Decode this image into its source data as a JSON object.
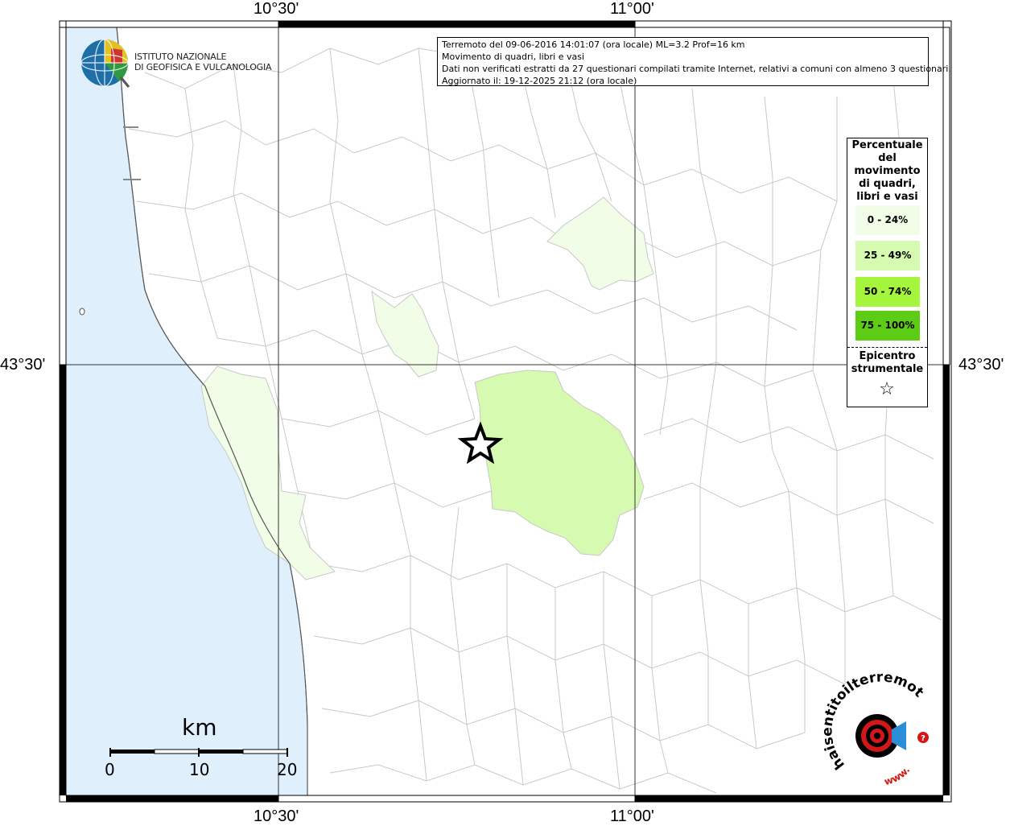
{
  "map": {
    "coords": {
      "top_left": "10°30'",
      "top_right": "11°00'",
      "bottom_left": "10°30'",
      "bottom_right": "11°00'",
      "left_lat": "43°30'",
      "right_lat": "43°30'"
    },
    "colors": {
      "sea": "#dff0fc",
      "land": "#ffffff",
      "border": "#c8c8c8",
      "class_0_24": "#f2fde8",
      "class_25_49": "#d6fbb0",
      "class_50_74": "#a4f53c",
      "class_75_100": "#5ccc14"
    }
  },
  "header": {
    "logo_line1": "ISTITUTO NAZIONALE",
    "logo_line2": "DI GEOFISICA E VULCANOLOGIA"
  },
  "info": {
    "line1": "Terremoto del 09-06-2016 14:01:07 (ora locale) ML=3.2 Prof=16 km",
    "line2": "Movimento di quadri, libri e vasi",
    "line3": "Dati non verificati estratti da 27 questionari compilati tramite Internet, relativi a comuni con almeno 3 questionari.",
    "line4": "Aggiornato il: 19-12-2025 21:12 (ora locale)"
  },
  "legend": {
    "title_lines": [
      "Percentuale",
      "del",
      "movimento",
      "di quadri,",
      "libri e vasi"
    ],
    "items": [
      {
        "label": "0 - 24%",
        "color": "#f2fde8"
      },
      {
        "label": "25 - 49%",
        "color": "#d6fbb0"
      },
      {
        "label": "50 - 74%",
        "color": "#a4f53c"
      },
      {
        "label": "75 - 100%",
        "color": "#5ccc14"
      }
    ],
    "epicenter_lines": [
      "Epicentro",
      "strumentale"
    ],
    "epicenter_symbol": "☆"
  },
  "scale": {
    "unit": "km",
    "labels": [
      "0",
      "10",
      "20"
    ]
  },
  "watermark": {
    "text_main": "haisentitoilterremoto.it",
    "text_www": "www."
  }
}
